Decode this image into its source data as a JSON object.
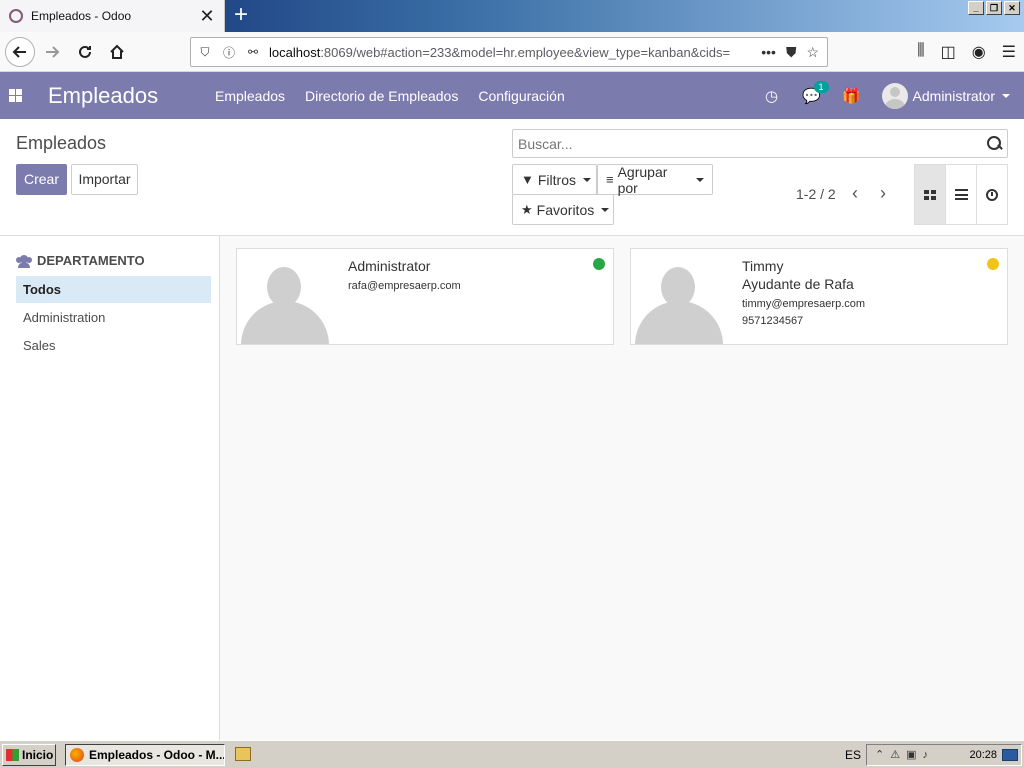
{
  "browser": {
    "tab_title": "Empleados - Odoo",
    "tab_close": "✕",
    "new_tab": "+",
    "url_host": "localhost",
    "url_rest": ":8069/web#action=233&model=hr.employee&view_type=kanban&cids=",
    "url_dots": "•••"
  },
  "odoo": {
    "app_title": "Empleados",
    "menu": [
      "Empleados",
      "Directorio de Empleados",
      "Configuración"
    ],
    "messages_count": "1",
    "user_name": "Administrator"
  },
  "control_panel": {
    "breadcrumb": "Empleados",
    "create_label": "Crear",
    "import_label": "Importar",
    "search_placeholder": "Buscar...",
    "filters_label": "Filtros",
    "group_by_label": "Agrupar por",
    "favorites_label": "Favoritos",
    "pager": "1-2 / 2"
  },
  "sidebar": {
    "header": "DEPARTAMENTO",
    "items": [
      "Todos",
      "Administration",
      "Sales"
    ],
    "selected": "Todos"
  },
  "employees": [
    {
      "name": "Administrator",
      "job": "",
      "email": "rafa@empresaerp.com",
      "phone": "",
      "status_color": "#28a745"
    },
    {
      "name": "Timmy",
      "job": "Ayudante de Rafa",
      "email": "timmy@empresaerp.com",
      "phone": "9571234567",
      "status_color": "#f0c419"
    }
  ],
  "taskbar": {
    "start_label": "Inicio",
    "task_label": "Empleados - Odoo - M...",
    "lang": "ES",
    "time": "20:28"
  },
  "colors": {
    "odoo_primary": "#7c7bad",
    "sidebar_selected": "#d9eaf6"
  }
}
